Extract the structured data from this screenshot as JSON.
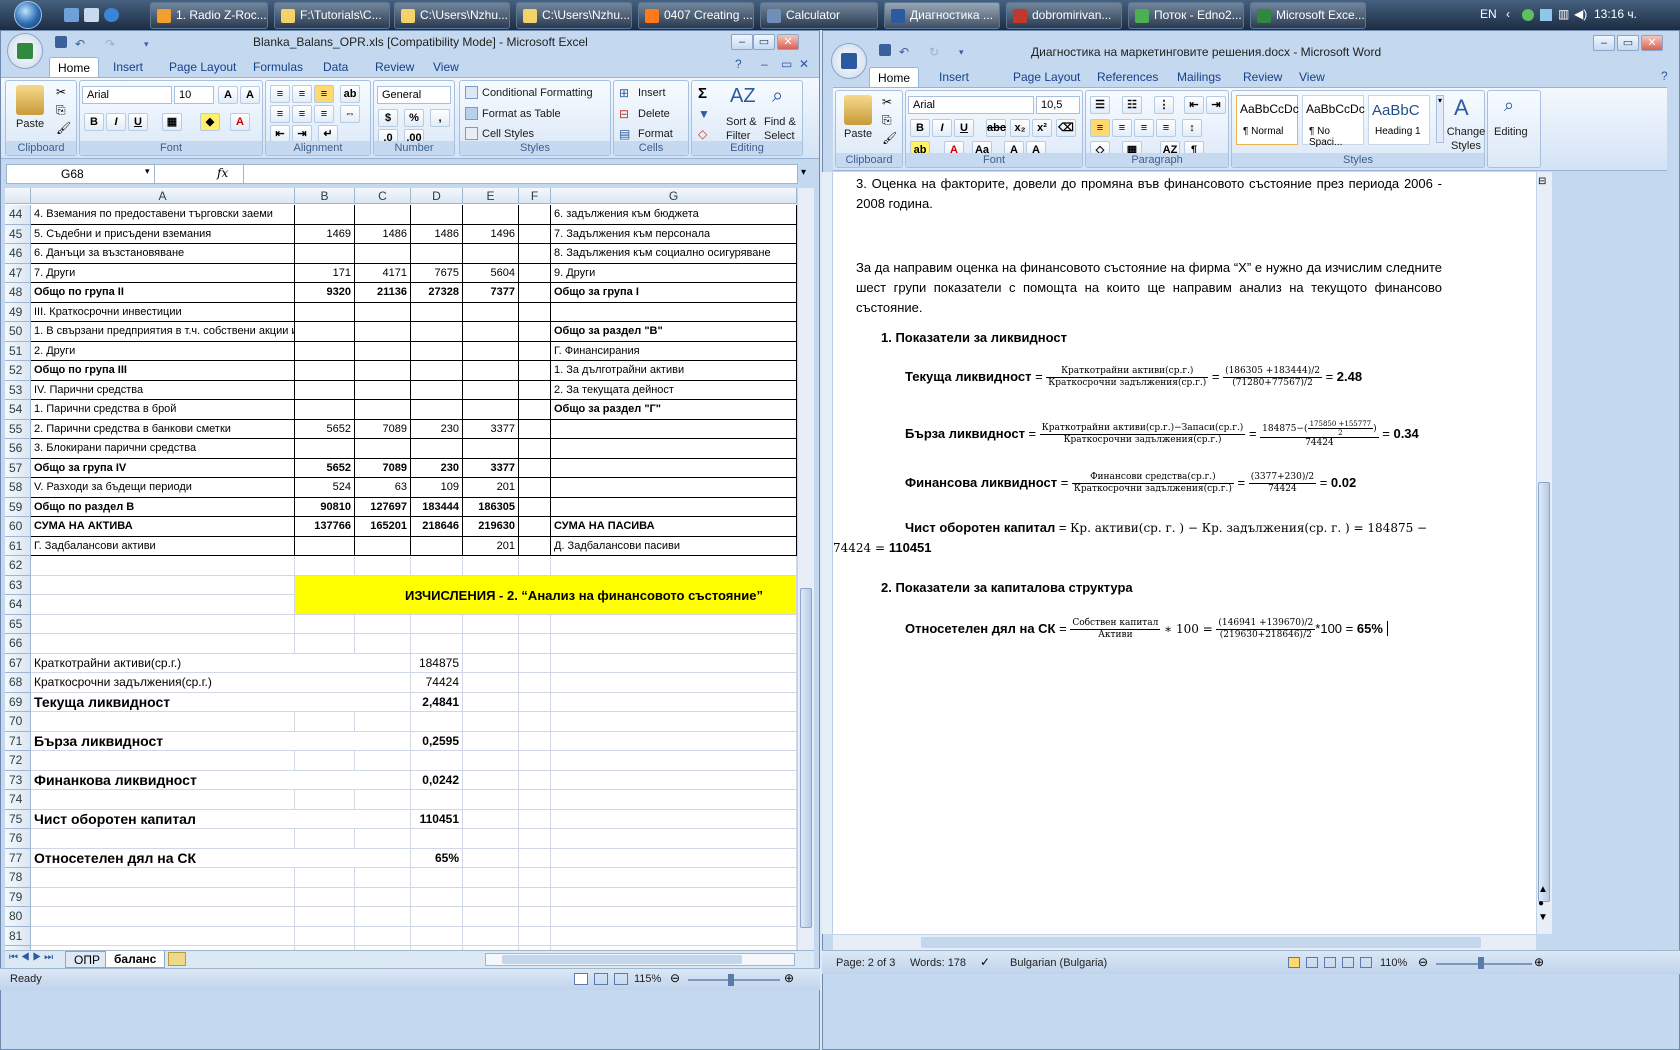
{
  "taskbar": {
    "items": [
      {
        "label": "1. Radio Z-Roc...",
        "icon": "winamp-icon"
      },
      {
        "label": "F:\\Tutorials\\C...",
        "icon": "folder-icon"
      },
      {
        "label": "C:\\Users\\Nzhu...",
        "icon": "folder-icon"
      },
      {
        "label": "C:\\Users\\Nzhu...",
        "icon": "folder-icon"
      },
      {
        "label": "0407 Creating ...",
        "icon": "media-icon"
      },
      {
        "label": "Calculator",
        "icon": "calculator-icon"
      },
      {
        "label": "Диагностика ...",
        "icon": "word-icon"
      },
      {
        "label": "dobromirivan...",
        "icon": "filezilla-icon"
      },
      {
        "label": "Поток - Edno2...",
        "icon": "chrome-icon"
      },
      {
        "label": "Microsoft Exce...",
        "icon": "excel-icon"
      }
    ],
    "lang": "EN",
    "clock": "13:16 ч."
  },
  "excel": {
    "title": "Blanka_Balans_OPR.xls  [Compatibility Mode]  -  Microsoft Excel",
    "tabs": [
      "Home",
      "Insert",
      "Page Layout",
      "Formulas",
      "Data",
      "Review",
      "View"
    ],
    "ribbon": {
      "paste": "Paste",
      "font_name": "Arial",
      "font_size": "10",
      "number_format": "General",
      "conditional": "Conditional Formatting",
      "format_table": "Format as Table",
      "cell_styles": "Cell Styles",
      "insert": "Insert",
      "delete": "Delete",
      "format": "Format",
      "sort": "Sort & Filter",
      "find": "Find & Select",
      "groups": [
        "Clipboard",
        "Font",
        "Alignment",
        "Number",
        "Styles",
        "Cells",
        "Editing"
      ]
    },
    "name_box": "G68",
    "fx": "fx",
    "columns": [
      "A",
      "B",
      "C",
      "D",
      "E",
      "F",
      "G"
    ],
    "rows": [
      {
        "n": "44",
        "a": "4. Вземания по предоставени търговски заеми",
        "b": "",
        "c": "",
        "d": "",
        "e": "",
        "g": "6. задължения към бюджета"
      },
      {
        "n": "45",
        "a": "5. Съдебни и присъдени вземания",
        "b": "1469",
        "c": "1486",
        "d": "1486",
        "e": "1496",
        "g": "7. Задължения към персонала"
      },
      {
        "n": "46",
        "a": "6. Данъци за възстановяване",
        "b": "",
        "c": "",
        "d": "",
        "e": "",
        "g": "8. Задължения към социално осигуряване"
      },
      {
        "n": "47",
        "a": "7. Други",
        "b": "171",
        "c": "4171",
        "d": "7675",
        "e": "5604",
        "g": "9. Други"
      },
      {
        "n": "48",
        "a": "Общо по група II",
        "b": "9320",
        "c": "21136",
        "d": "27328",
        "e": "7377",
        "g": "Общо за група I",
        "bold": true
      },
      {
        "n": "49",
        "a": "III. Краткосрочни инвестиции",
        "b": "",
        "c": "",
        "d": "",
        "e": "",
        "g": ""
      },
      {
        "n": "50",
        "a": "1. В свързани предприятия в т.ч. собствени акции и облигации",
        "b": "",
        "c": "",
        "d": "",
        "e": "",
        "g": "Общо за раздел \"В\"",
        "gbold": true
      },
      {
        "n": "51",
        "a": "2. Други",
        "b": "",
        "c": "",
        "d": "",
        "e": "",
        "g": "Г. Финансирания"
      },
      {
        "n": "52",
        "a": "Общо по група III",
        "b": "",
        "c": "",
        "d": "",
        "e": "",
        "g": "1. За дълготрайни активи",
        "abold": true
      },
      {
        "n": "53",
        "a": "IV. Парични средства",
        "b": "",
        "c": "",
        "d": "",
        "e": "",
        "g": "2. За текущата дейност"
      },
      {
        "n": "54",
        "a": "1. Парични средства в брой",
        "b": "",
        "c": "",
        "d": "",
        "e": "",
        "g": "Общо за раздел \"Г\"",
        "gbold": true
      },
      {
        "n": "55",
        "a": "2. Парични средства в банкови сметки",
        "b": "5652",
        "c": "7089",
        "d": "230",
        "e": "3377",
        "g": ""
      },
      {
        "n": "56",
        "a": "3. Блокирани парични средства",
        "b": "",
        "c": "",
        "d": "",
        "e": "",
        "g": ""
      },
      {
        "n": "57",
        "a": "Общо за група IV",
        "b": "5652",
        "c": "7089",
        "d": "230",
        "e": "3377",
        "g": "",
        "bold": true
      },
      {
        "n": "58",
        "a": "V. Разходи за бъдещи периоди",
        "b": "524",
        "c": "63",
        "d": "109",
        "e": "201",
        "g": ""
      },
      {
        "n": "59",
        "a": "Общо по раздел В",
        "b": "90810",
        "c": "127697",
        "d": "183444",
        "e": "186305",
        "g": "",
        "bold": true
      },
      {
        "n": "60",
        "a": "СУМА НА АКТИВА",
        "b": "137766",
        "c": "165201",
        "d": "218646",
        "e": "219630",
        "g": "СУМА НА ПАСИВА",
        "bold": true
      },
      {
        "n": "61",
        "a": "Г. Задбалансови активи",
        "b": "",
        "c": "",
        "d": "",
        "e": "201",
        "g": "Д. Задбалансови пасиви"
      }
    ],
    "calc_title": "ИЗЧИСЛЕНИЯ - 2. “Анализ на финансовото състояние”",
    "calc_rows": [
      {
        "n": "67",
        "label": "Краткотрайни активи(ср.г.)",
        "value": "184875"
      },
      {
        "n": "68",
        "label": "Краткосрочни задължения(ср.г.)",
        "value": "74424"
      },
      {
        "n": "69",
        "label": "Текуща ликвидност",
        "value": "2,4841",
        "big": true
      },
      {
        "n": "71",
        "label": "Бърза ликвидност",
        "value": "0,2595",
        "big": true
      },
      {
        "n": "73",
        "label": "Финанкова ликвидност",
        "value": "0,0242",
        "big": true
      },
      {
        "n": "75",
        "label": "Чист оборотен капитал",
        "value": "110451",
        "big": true
      },
      {
        "n": "77",
        "label": "Относетелен дял на СК",
        "value": "65%",
        "big": true
      }
    ],
    "empty_rows": [
      "62",
      "63",
      "64",
      "65",
      "66",
      "70",
      "72",
      "74",
      "76",
      "78",
      "79",
      "80",
      "81",
      "82"
    ],
    "sheet_tabs": [
      "ОПР",
      "баланс"
    ],
    "status": "Ready",
    "zoom": "115%"
  },
  "word": {
    "title": "Диагностика на маркетинговите решения.docx - Microsoft Word",
    "tabs": [
      "Home",
      "Insert",
      "Page Layout",
      "References",
      "Mailings",
      "Review",
      "View"
    ],
    "ribbon": {
      "paste": "Paste",
      "font_name": "Arial",
      "font_size": "10,5",
      "styles": [
        {
          "preview": "AaBbCcDc",
          "name": "¶ Normal"
        },
        {
          "preview": "AaBbCcDc",
          "name": "¶ No Spaci..."
        },
        {
          "preview": "AaBbC",
          "name": "Heading 1"
        }
      ],
      "change_styles": "Change Styles",
      "editing": "Editing",
      "groups": [
        "Clipboard",
        "Font",
        "Paragraph",
        "Styles"
      ]
    },
    "doc": {
      "p1": "3. Оценка на факторите,  довели до промяна  във финансовото  състояние  през периода 2006 - 2008 година.",
      "p2": "За да направим  оценка на финансовото  състояние  на фирма  “X” е нужно  да изчислим следните шест групи показатели  с помощта  на които ще направим  анализ  на текущото финансово  състояние.",
      "h1": "1.   Показатели  за  ликвидност",
      "f1": {
        "label": "Текуща ликвидност",
        "n1": "Краткотрайни активи(ср.г.)",
        "d1": "Краткосрочни задължения(ср.г.)",
        "n2": "(186305 +183444)/2",
        "d2": "(71280+77567)/2",
        "res": "2.48"
      },
      "f2": {
        "label": "Бърза ликвидност",
        "n1": "Краткотрайни активи(ср.г.)−Запаси(ср.г.)",
        "d1": "Краткосрочни задължения(ср.г.)",
        "n2a": "184875−(",
        "n2b": "175850 +155777",
        "n2c": "2",
        "d2": "74424",
        "res": "0.34"
      },
      "f3": {
        "label": "Финансова ликвидност",
        "n1": "Финансови средства(ср.г.)",
        "d1": "Краткосрочни задължения(ср.г.)",
        "n2": "(3377+230)/2",
        "d2": "74424",
        "res": "0.02"
      },
      "f4": {
        "label": "Чист оборотен капитал",
        "expr": "Кр. активи(ср. г. ) − Кр. задължения(ср. г. ) = 184875 −",
        "expr2": "74424 = ",
        "res": "110451"
      },
      "h2": "2.   Показатели  за  капиталова  структура",
      "f5": {
        "label": "Относетелен дял на СК",
        "n1": "Собствен капитал",
        "d1": "Активи",
        "mult": "∗ 100 =",
        "n2": "(146941 +139670)/2",
        "d2": "(219630+218646)/2",
        "tail": "*100 =",
        "res": "65%"
      }
    },
    "status": {
      "page": "Page: 2 of 3",
      "words": "Words: 178",
      "lang": "Bulgarian (Bulgaria)",
      "zoom": "110%"
    }
  },
  "colors": {
    "highlight": "#ffff00",
    "accent": "#15428b"
  }
}
